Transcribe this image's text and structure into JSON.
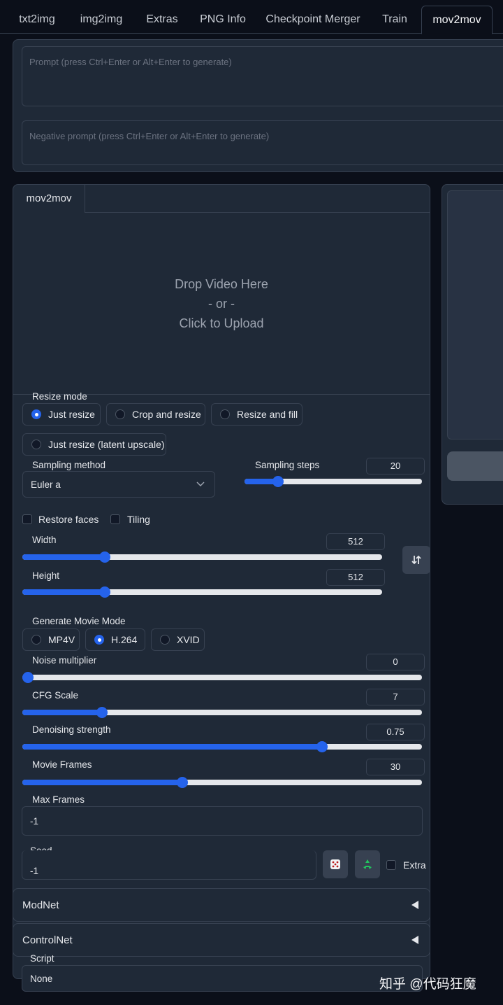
{
  "tabs": [
    {
      "label": "txt2img",
      "active": false
    },
    {
      "label": "img2img",
      "active": false
    },
    {
      "label": "Extras",
      "active": false
    },
    {
      "label": "PNG Info",
      "active": false
    },
    {
      "label": "Checkpoint Merger",
      "active": false
    },
    {
      "label": "Train",
      "active": false
    },
    {
      "label": "mov2mov",
      "active": true
    }
  ],
  "prompt": {
    "placeholder": "Prompt (press Ctrl+Enter or Alt+Enter to generate)"
  },
  "negative_prompt": {
    "placeholder": "Negative prompt (press Ctrl+Enter or Alt+Enter to generate)"
  },
  "input_tab": {
    "label": "mov2mov"
  },
  "dropzone": {
    "line1": "Drop Video Here",
    "line2": "- or -",
    "line3": "Click to Upload"
  },
  "resize_mode": {
    "label": "Resize mode",
    "options": [
      "Just resize",
      "Crop and resize",
      "Resize and fill",
      "Just resize (latent upscale)"
    ],
    "selected": "Just resize"
  },
  "sampling_method": {
    "label": "Sampling method",
    "value": "Euler a"
  },
  "sampling_steps": {
    "label": "Sampling steps",
    "value": "20",
    "fraction": 0.19
  },
  "restore_faces": {
    "label": "Restore faces",
    "checked": false
  },
  "tiling": {
    "label": "Tiling",
    "checked": false
  },
  "width": {
    "label": "Width",
    "value": "512",
    "fraction": 0.23
  },
  "height": {
    "label": "Height",
    "value": "512",
    "fraction": 0.23
  },
  "movie_mode": {
    "label": "Generate Movie Mode",
    "options": [
      "MP4V",
      "H.264",
      "XVID"
    ],
    "selected": "H.264"
  },
  "noise_multiplier": {
    "label": "Noise multiplier",
    "value": "0",
    "fraction": 0.0
  },
  "cfg_scale": {
    "label": "CFG Scale",
    "value": "7",
    "fraction": 0.2
  },
  "denoising_strength": {
    "label": "Denoising strength",
    "value": "0.75",
    "fraction": 0.75
  },
  "movie_frames": {
    "label": "Movie Frames",
    "value": "30",
    "fraction": 0.4
  },
  "max_frames": {
    "label": "Max Frames",
    "value": "-1"
  },
  "seed": {
    "label": "Seed",
    "value": "-1",
    "extra_label": "Extra"
  },
  "modnet": {
    "label": "ModNet"
  },
  "controlnet": {
    "label": "ControlNet"
  },
  "script": {
    "label": "Script",
    "value": "None"
  },
  "watermark": "知乎 @代码狂魔",
  "colors": {
    "accent": "#2563eb",
    "background": "#0b0f19",
    "panel": "#1f2937",
    "border": "#374151"
  }
}
